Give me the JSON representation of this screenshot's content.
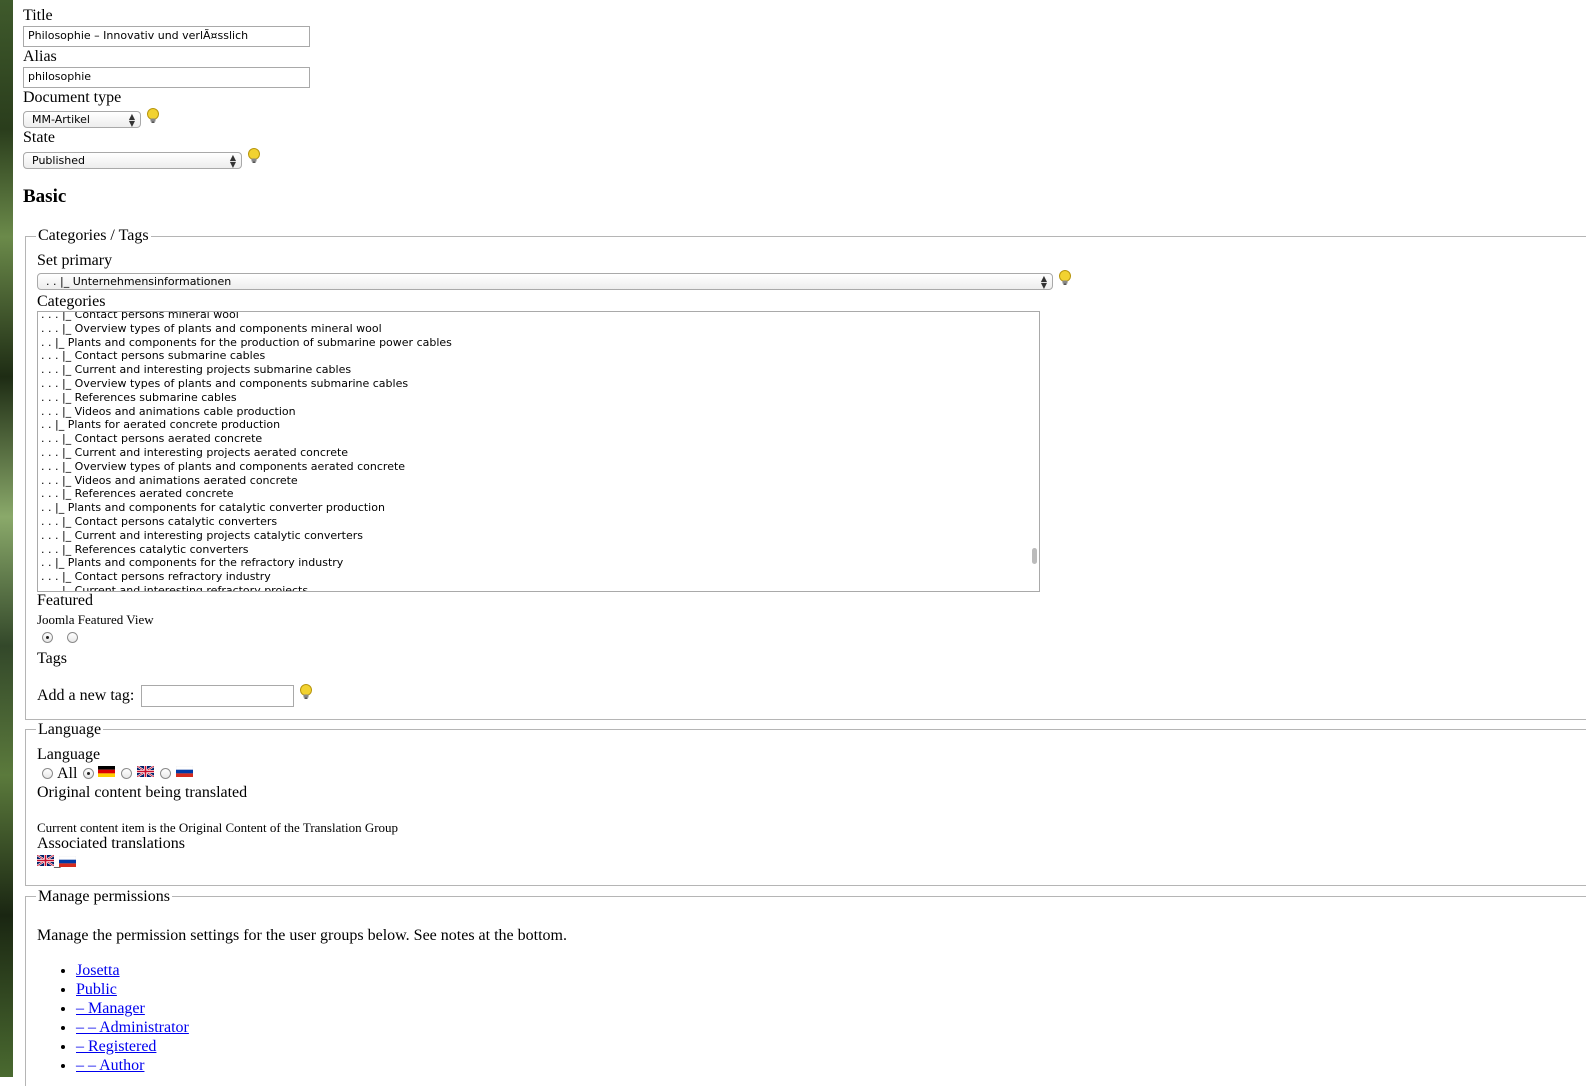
{
  "form": {
    "title_label": "Title",
    "title_value": "Philosophie – Innovativ und verlÃ¤sslich",
    "alias_label": "Alias",
    "alias_value": "philosophie",
    "doctype_label": "Document type",
    "doctype_value": "MM-Artikel",
    "state_label": "State",
    "state_value": "Published",
    "basic_heading": "Basic"
  },
  "categories": {
    "legend": "Categories / Tags",
    "set_primary_label": "Set primary",
    "set_primary_value": ". . |_ Unternehmensinformationen",
    "categories_label": "Categories",
    "items": [
      ". . . |_ Contact persons mineral wool",
      ". . . |_ Overview types of plants and components mineral wool",
      ". . |_ Plants and components for the production of submarine power cables",
      ". . . |_ Contact persons submarine cables",
      ". . . |_ Current and interesting projects submarine cables",
      ". . . |_ Overview types of plants and components submarine cables",
      ". . . |_ References submarine cables",
      ". . . |_ Videos and animations cable production",
      ". . |_ Plants for aerated concrete production",
      ". . . |_ Contact persons aerated concrete",
      ". . . |_ Current and interesting projects aerated concrete",
      ". . . |_ Overview types of plants and components aerated concrete",
      ". . . |_ Videos and animations aerated concrete",
      ". . . |_ References aerated concrete",
      ". . |_ Plants and components for catalytic converter production",
      ". . . |_ Contact persons catalytic converters",
      ". . . |_ Current and interesting projects catalytic converters",
      ". . . |_ References catalytic converters",
      ". . |_ Plants and components for the refractory industry",
      ". . . |_ Contact persons refractory industry",
      ". . . |_ Current and interesting refractory projects"
    ],
    "featured_label": "Featured",
    "featured_view": "Joomla Featured View",
    "tags_label": "Tags",
    "add_tag_label": "Add a new tag:"
  },
  "language": {
    "legend": "Language",
    "label": "Language",
    "all_label": "All",
    "original_label": "Original content being translated",
    "original_text": "Current content item is the Original Content of the Translation Group",
    "assoc_label": "Associated translations",
    "assoc_sep": "_"
  },
  "permissions": {
    "legend": "Manage permissions",
    "intro": "Manage the permission settings for the user groups below. See notes at the bottom.",
    "groups": [
      "Josetta",
      "Public",
      "– Manager",
      "– – Administrator",
      "– Registered",
      "– – Author"
    ]
  },
  "colors": {
    "link": "#0000ee",
    "bulb": "#f2d230"
  },
  "icons": [
    "hint-bulb-icon",
    "flag-de-icon",
    "flag-uk-icon",
    "flag-ru-icon"
  ]
}
